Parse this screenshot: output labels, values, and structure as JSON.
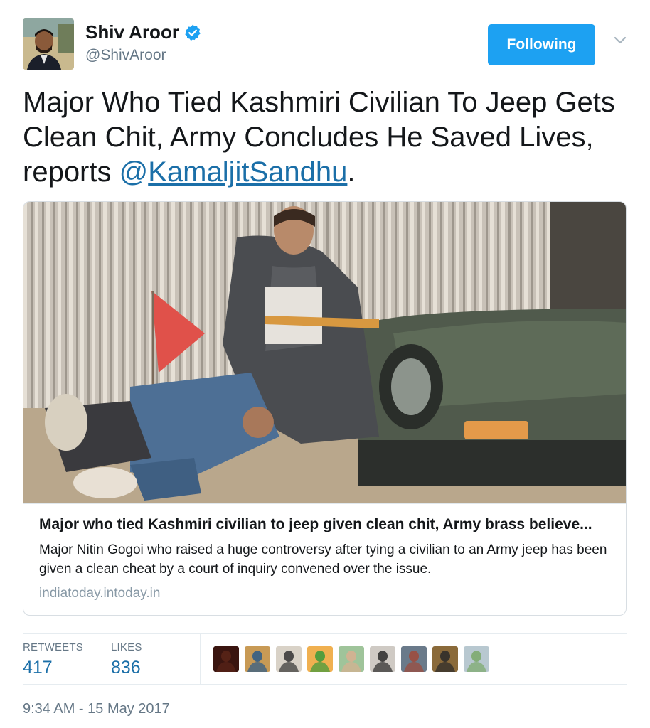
{
  "user": {
    "name": "Shiv Aroor",
    "handle": "@ShivAroor",
    "verified": true
  },
  "follow_button": {
    "label": "Following"
  },
  "tweet": {
    "text_before_mention": "Major Who Tied Kashmiri Civilian To Jeep Gets Clean Chit, Army Concludes He Saved Lives, reports ",
    "mention_at": "@",
    "mention_name": "KamaljitSandhu",
    "text_after_mention": "."
  },
  "card": {
    "title": "Major who tied Kashmiri civilian to jeep given clean chit, Army brass believe...",
    "description": "Major Nitin Gogoi who raised a huge controversy after tying a civilian to an Army jeep has been given a clean cheat by a court of inquiry convened over the issue.",
    "domain": "indiatoday.intoday.in"
  },
  "stats": {
    "retweets_label": "RETWEETS",
    "retweets_value": "417",
    "likes_label": "LIKES",
    "likes_value": "836"
  },
  "likers": [
    {
      "color": "#3a1510",
      "accent": "#5a2418"
    },
    {
      "color": "#c89a55",
      "accent": "#2a5a8a"
    },
    {
      "color": "#d9d2c7",
      "accent": "#333333"
    },
    {
      "color": "#f0b050",
      "accent": "#3a9a3a"
    },
    {
      "color": "#9fc49a",
      "accent": "#d8b090"
    },
    {
      "color": "#cfcac4",
      "accent": "#2a2a2a"
    },
    {
      "color": "#6a7a8a",
      "accent": "#a04a3a"
    },
    {
      "color": "#8a6a3a",
      "accent": "#2a2a2a"
    },
    {
      "color": "#b8c8d0",
      "accent": "#7aa86a"
    }
  ],
  "timestamp": "9:34 AM - 15 May 2017",
  "colors": {
    "follow_button": "#1da1f2",
    "link": "#1b6fa8",
    "secondary_text": "#657786",
    "verified_badge": "#1da1f2"
  }
}
